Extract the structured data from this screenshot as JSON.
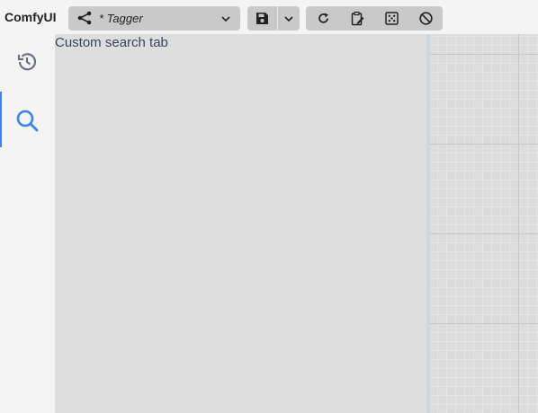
{
  "app": {
    "brand": "ComfyUI"
  },
  "workflow": {
    "name": "* Tagger",
    "icon": "share-nodes-icon"
  },
  "toolbar": {
    "save_icon": "save-icon",
    "save_dropdown_icon": "chevron-down-icon",
    "tools": [
      {
        "name": "refresh",
        "icon": "refresh-icon"
      },
      {
        "name": "clipboard-edit",
        "icon": "clipboard-edit-icon"
      },
      {
        "name": "fit-view",
        "icon": "fit-view-icon"
      },
      {
        "name": "cancel",
        "icon": "ban-icon"
      }
    ]
  },
  "sidebar": {
    "items": [
      {
        "name": "queue-history",
        "icon": "history-icon",
        "active": false
      },
      {
        "name": "search",
        "icon": "search-icon",
        "active": true
      }
    ],
    "accent": "#3b82f6"
  },
  "panel": {
    "text": "Custom search tab"
  }
}
